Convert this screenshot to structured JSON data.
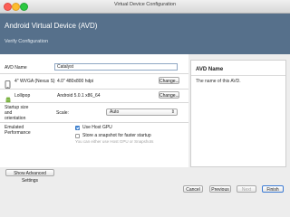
{
  "window": {
    "title": "Virtual Device Configuration"
  },
  "header": {
    "title": "Android Virtual Device (AVD)",
    "subtitle": "Verify Configuration"
  },
  "form": {
    "avd_name_label": "AVD Name",
    "avd_name_value": "Catalyst",
    "device_value": "4\" WVGA (Nexus S)",
    "device_spec": "4.0\" 480x800 hdpi",
    "change_label": "Change...",
    "system_value": "Lollipop",
    "system_spec": "Android 5.0.1 x86_64",
    "startup_label": "Startup size and orientation",
    "scale_label": "Scale:",
    "scale_value": "Auto",
    "emulated_label": "Emulated Performance",
    "use_host_gpu": "Use Host GPU",
    "use_host_gpu_checked": true,
    "store_snapshot": "Store a snapshot for faster startup",
    "store_snapshot_checked": false,
    "hint": "You can either use Host GPU or Snapshots"
  },
  "help": {
    "title": "AVD Name",
    "text": "The name of this AVD."
  },
  "buttons": {
    "show_advanced": "Show Advanced Settings",
    "cancel": "Cancel",
    "previous": "Previous",
    "next": "Next",
    "finish": "Finish"
  },
  "colors": {
    "header_bg": "#56708b",
    "accent": "#4a90e2",
    "finish_border": "#3d7bd4"
  },
  "icons": {
    "device": "phone-icon",
    "system": "android-icon"
  }
}
